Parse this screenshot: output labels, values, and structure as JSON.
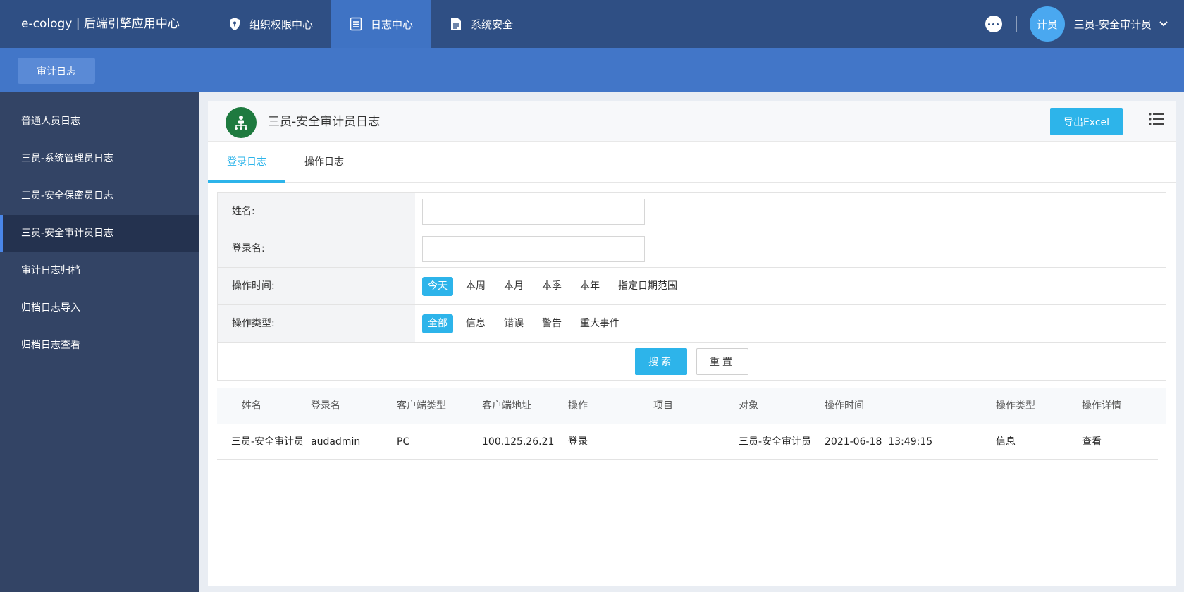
{
  "app": {
    "brand": "e-cology | 后端引擎应用中心"
  },
  "topnav": [
    {
      "label": "组织权限中心",
      "icon": "shield-icon"
    },
    {
      "label": "日志中心",
      "icon": "document-list-icon"
    },
    {
      "label": "系统安全",
      "icon": "file-icon"
    }
  ],
  "user": {
    "avatar_text": "计员",
    "name": "三员-安全审计员"
  },
  "subbar": {
    "tab": "审计日志"
  },
  "sidebar": {
    "items": [
      {
        "label": "普通人员日志"
      },
      {
        "label": "三员-系统管理员日志"
      },
      {
        "label": "三员-安全保密员日志"
      },
      {
        "label": "三员-安全审计员日志"
      },
      {
        "label": "审计日志归档"
      },
      {
        "label": "归档日志导入"
      },
      {
        "label": "归档日志查看"
      }
    ],
    "active_index": 3
  },
  "panel": {
    "title": "三员-安全审计员日志",
    "export_label": "导出Excel",
    "tabs": [
      "登录日志",
      "操作日志"
    ]
  },
  "form": {
    "name_label": "姓名:",
    "name_value": "",
    "login_label": "登录名:",
    "login_value": "",
    "time_label": "操作时间:",
    "time_options": [
      "今天",
      "本周",
      "本月",
      "本季",
      "本年",
      "指定日期范围"
    ],
    "time_selected": 0,
    "type_label": "操作类型:",
    "type_options": [
      "全部",
      "信息",
      "错误",
      "警告",
      "重大事件"
    ],
    "type_selected": 0,
    "search_label": "搜索",
    "reset_label": "重置"
  },
  "table": {
    "headers": [
      "姓名",
      "登录名",
      "客户端类型",
      "客户端地址",
      "操作",
      "项目",
      "对象",
      "操作时间",
      "操作类型",
      "操作详情"
    ],
    "rows": [
      [
        "三员-安全审计员",
        "audadmin",
        "PC",
        "100.125.26.21",
        "登录",
        "",
        "三员-安全审计员",
        "2021-06-18  13:49:15",
        "信息",
        "查看"
      ]
    ]
  },
  "colors": {
    "topbar": "#2f4f84",
    "accent": "#2db4ea",
    "sidebar": "#334465"
  }
}
